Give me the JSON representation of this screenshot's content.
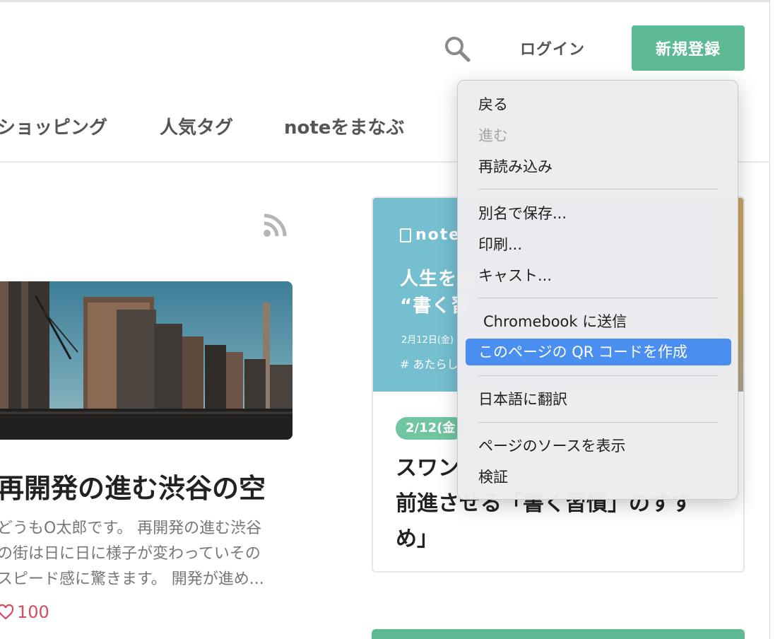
{
  "header": {
    "login_label": "ログイン",
    "signup_label": "新規登録"
  },
  "nav": {
    "items": [
      {
        "label": "ショッピング"
      },
      {
        "label": "人気タグ"
      },
      {
        "label": "noteをまなぶ"
      }
    ]
  },
  "main_article": {
    "title": "再開発の進む渋谷の空",
    "excerpt_lines": [
      "どうもO太郎です。 再開発の進む渋谷",
      "の街は日に日に様子が変わっていその",
      "スピード感に驚きます。 開発が進め..."
    ],
    "like_count": "100"
  },
  "feature_card": {
    "banner": {
      "logo_text": "note",
      "headline_lines": [
        "人生を前",
        "“書く習"
      ],
      "date_text": "2月12日(金)",
      "tag_text": "# あたらし"
    },
    "badge": "2/12(金",
    "title_lines": [
      "スワン",
      "前進させる「書く習慣」のすす",
      "め」"
    ]
  },
  "context_menu": {
    "items": [
      {
        "label": "戻る",
        "enabled": true
      },
      {
        "label": "進む",
        "enabled": false
      },
      {
        "label": "再読み込み",
        "enabled": true
      },
      {
        "label": "別名で保存...",
        "enabled": true
      },
      {
        "label": "印刷...",
        "enabled": true
      },
      {
        "label": "キャスト...",
        "enabled": true
      },
      {
        "label": "Chromebook に送信",
        "enabled": true
      },
      {
        "label": "このページの QR コードを作成",
        "enabled": true,
        "highlighted": true
      },
      {
        "label": "日本語に翻訳",
        "enabled": true
      },
      {
        "label": "ページのソースを表示",
        "enabled": true
      },
      {
        "label": "検証",
        "enabled": true
      }
    ]
  },
  "colors": {
    "accent_green": "#5dba94",
    "menu_highlight": "#4a8ff0",
    "like_red": "#d84b5f"
  }
}
